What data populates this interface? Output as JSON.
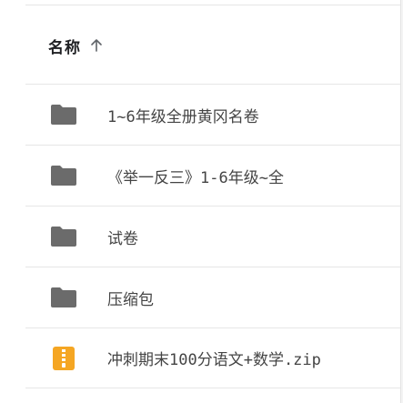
{
  "header": {
    "column_label": "名称",
    "sort_icon": "arrow-up-icon"
  },
  "files": [
    {
      "name": "1~6年级全册黄冈名卷",
      "type": "folder",
      "icon": "folder-icon"
    },
    {
      "name": "《举一反三》1-6年级~全",
      "type": "folder",
      "icon": "folder-icon"
    },
    {
      "name": "试卷",
      "type": "folder",
      "icon": "folder-icon"
    },
    {
      "name": "压缩包",
      "type": "folder",
      "icon": "folder-icon"
    },
    {
      "name": "冲刺期末100分语文+数学.zip",
      "type": "zip",
      "icon": "zip-file-icon"
    }
  ],
  "colors": {
    "folder": "#6b6b6b",
    "zip": "#f5a623",
    "text": "#444444",
    "divider": "#e6e6e6"
  }
}
